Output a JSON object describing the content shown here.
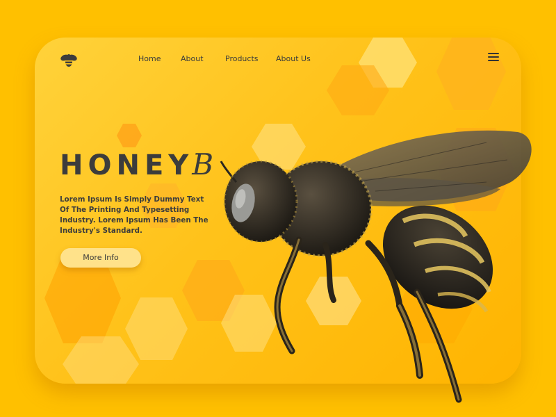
{
  "brand": {
    "name": "HONEY",
    "name_script": "B"
  },
  "nav": {
    "items": [
      {
        "label": "Home"
      },
      {
        "label": "About"
      },
      {
        "label": "Products"
      },
      {
        "label": "About Us"
      }
    ]
  },
  "hero": {
    "description": "Lorem Ipsum Is Simply Dummy Text Of The Printing And Typesetting Industry. Lorem Ipsum Has Been The Industry's Standard.",
    "button_label": "More Info"
  },
  "icons": {
    "logo": "bee-logo-icon",
    "menu": "hamburger-menu-icon"
  },
  "colors": {
    "background": "#FFC000",
    "card": "#FFC21A",
    "text": "#3C3C3C",
    "button": "#FFE28A"
  }
}
